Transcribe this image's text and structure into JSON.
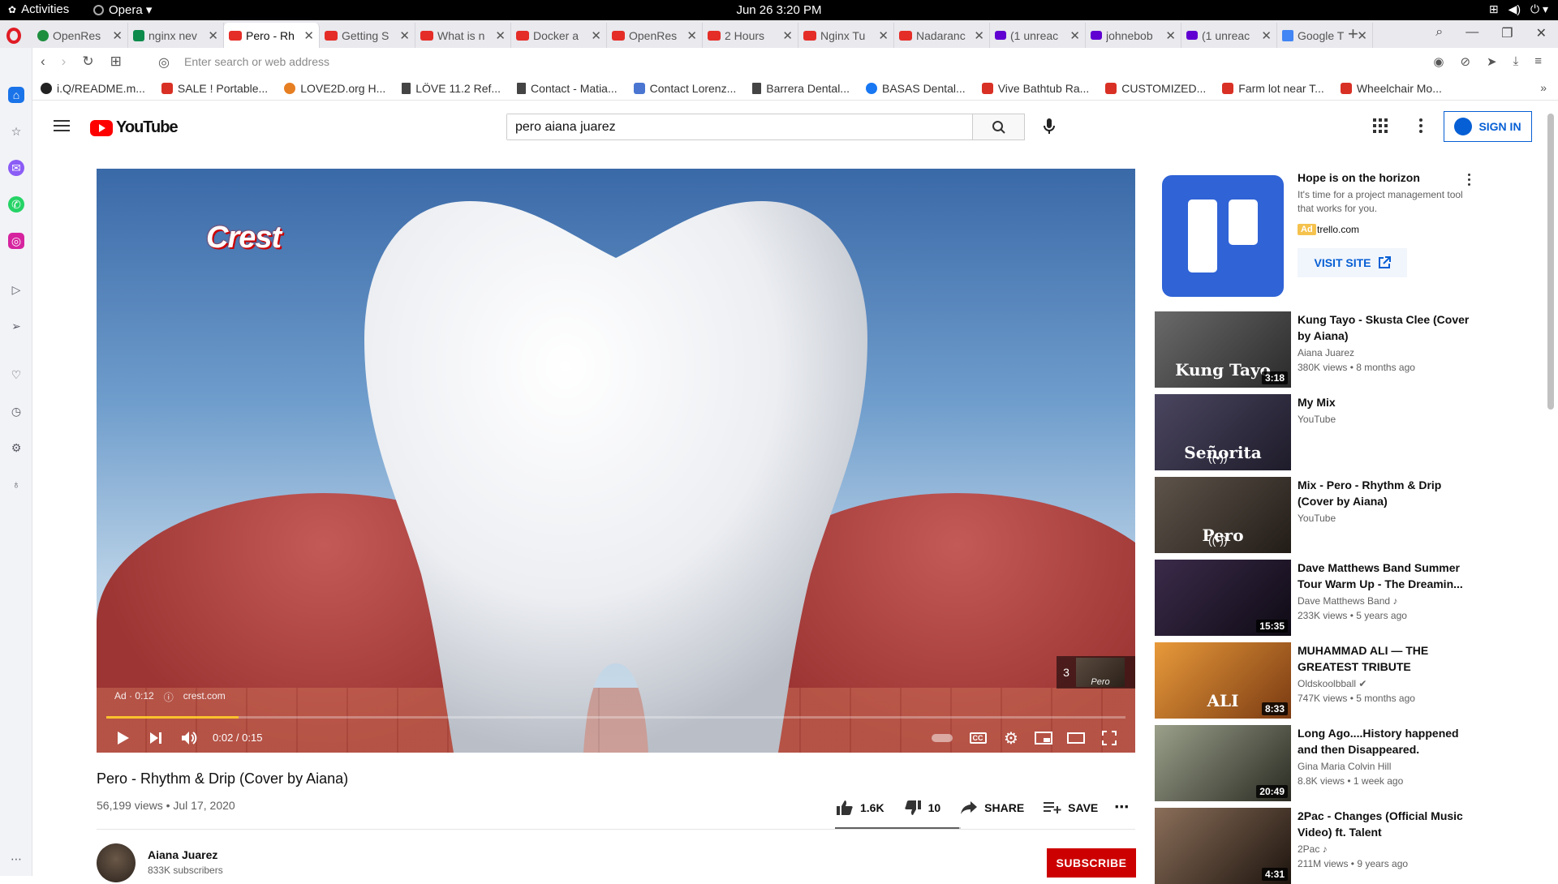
{
  "system": {
    "activities": "Activities",
    "browser_menu": "Opera ▾",
    "clock": "Jun 26  3:20 PM"
  },
  "tabs": [
    {
      "label": "OpenRes",
      "icon": "green-leaf-icon"
    },
    {
      "label": "nginx nev",
      "icon": "nginx-icon"
    },
    {
      "label": "Pero - Rh",
      "icon": "youtube-icon",
      "active": true
    },
    {
      "label": "Getting S",
      "icon": "youtube-icon"
    },
    {
      "label": "What is n",
      "icon": "youtube-icon"
    },
    {
      "label": "Docker a",
      "icon": "youtube-icon"
    },
    {
      "label": "OpenRes",
      "icon": "youtube-icon"
    },
    {
      "label": "2 Hours",
      "icon": "youtube-icon"
    },
    {
      "label": "Nginx Tu",
      "icon": "youtube-icon"
    },
    {
      "label": "Nadaranc",
      "icon": "youtube-icon"
    },
    {
      "label": "(1 unreac",
      "icon": "yahoo-mail-icon"
    },
    {
      "label": "johnebob",
      "icon": "yahoo-mail-icon"
    },
    {
      "label": "(1 unreac",
      "icon": "yahoo-mail-icon"
    },
    {
      "label": "Google T",
      "icon": "google-translate-icon"
    }
  ],
  "address": {
    "placeholder": "Enter search or web address"
  },
  "bookmarks": [
    {
      "label": "i.Q/README.m...",
      "icon": "gh"
    },
    {
      "label": "SALE ! Portable...",
      "icon": "red"
    },
    {
      "label": "LOVE2D.org H...",
      "icon": "love"
    },
    {
      "label": "LÖVE 11.2 Ref...",
      "icon": "doc"
    },
    {
      "label": "Contact - Matia...",
      "icon": "doc"
    },
    {
      "label": "Contact Lorenz...",
      "icon": "plus"
    },
    {
      "label": "Barrera Dental...",
      "icon": "doc"
    },
    {
      "label": "BASAS Dental...",
      "icon": "fb"
    },
    {
      "label": "Vive Bathtub Ra...",
      "icon": "red"
    },
    {
      "label": "CUSTOMIZED...",
      "icon": "red"
    },
    {
      "label": "Farm lot near T...",
      "icon": "red"
    },
    {
      "label": "Wheelchair Mo...",
      "icon": "red"
    }
  ],
  "youtube": {
    "logo_text": "YouTube",
    "search_query": "pero aiana juarez",
    "sign_in": "SIGN IN"
  },
  "player": {
    "brand": "Crest",
    "ad_label": "Ad · 0:12",
    "ad_domain": "crest.com",
    "time": "0:02 / 0:15",
    "ad_progress_fraction": 0.13,
    "upnext_count": "3",
    "upnext_thumb_text": "Pero"
  },
  "video": {
    "title": "Pero - Rhythm & Drip (Cover by Aiana)",
    "meta": "56,199 views • Jul 17, 2020",
    "likes": "1.6K",
    "dislikes": "10",
    "share": "SHARE",
    "save": "SAVE",
    "like_ratio": 0.99
  },
  "channel": {
    "name": "Aiana Juarez",
    "subs": "833K subscribers",
    "subscribe": "SUBSCRIBE"
  },
  "ad": {
    "title": "Hope is on the horizon",
    "desc": "It's time for a project management tool that works for you.",
    "badge": "Ad",
    "domain": "trello.com",
    "cta": "VISIT SITE"
  },
  "recommendations": [
    {
      "title": "Kung Tayo - Skusta Clee (Cover by Aiana)",
      "channel": "Aiana Juarez",
      "meta": "380K views • 8 months ago",
      "duration": "3:18",
      "thumb_text": "Kung Tayo",
      "colors": [
        "#6a6a6a",
        "#2a2a2a"
      ]
    },
    {
      "title": "My Mix",
      "channel": "YouTube",
      "meta": "",
      "duration": "",
      "thumb_text": "Señorita",
      "colors": [
        "#4b4660",
        "#1e1b2a"
      ]
    },
    {
      "title": "Mix - Pero - Rhythm & Drip (Cover by Aiana)",
      "channel": "YouTube",
      "meta": "",
      "duration": "",
      "thumb_text": "Pero",
      "colors": [
        "#5e544b",
        "#221c17"
      ]
    },
    {
      "title": "Dave Matthews Band Summer Tour Warm Up - The Dreamin...",
      "channel": "Dave Matthews Band ♪",
      "meta": "233K views • 5 years ago",
      "duration": "15:35",
      "thumb_text": "",
      "colors": [
        "#3b2b4a",
        "#0e0a14"
      ]
    },
    {
      "title": "MUHAMMAD ALI — THE GREATEST TRIBUTE",
      "channel": "Oldskoolbball ✔",
      "meta": "747K views • 5 months ago",
      "duration": "8:33",
      "thumb_text": "ALI",
      "colors": [
        "#e89a3a",
        "#7a3a12"
      ]
    },
    {
      "title": "Long Ago....History happened and then Disappeared.",
      "channel": "Gina Maria Colvin Hill",
      "meta": "8.8K views • 1 week ago",
      "duration": "20:49",
      "thumb_text": "",
      "colors": [
        "#9aa08a",
        "#2a2a22"
      ]
    },
    {
      "title": "2Pac - Changes (Official Music Video) ft. Talent",
      "channel": "2Pac ♪",
      "meta": "211M views • 9 years ago",
      "duration": "4:31",
      "thumb_text": "",
      "colors": [
        "#8b6f5a",
        "#1d140e"
      ]
    }
  ]
}
